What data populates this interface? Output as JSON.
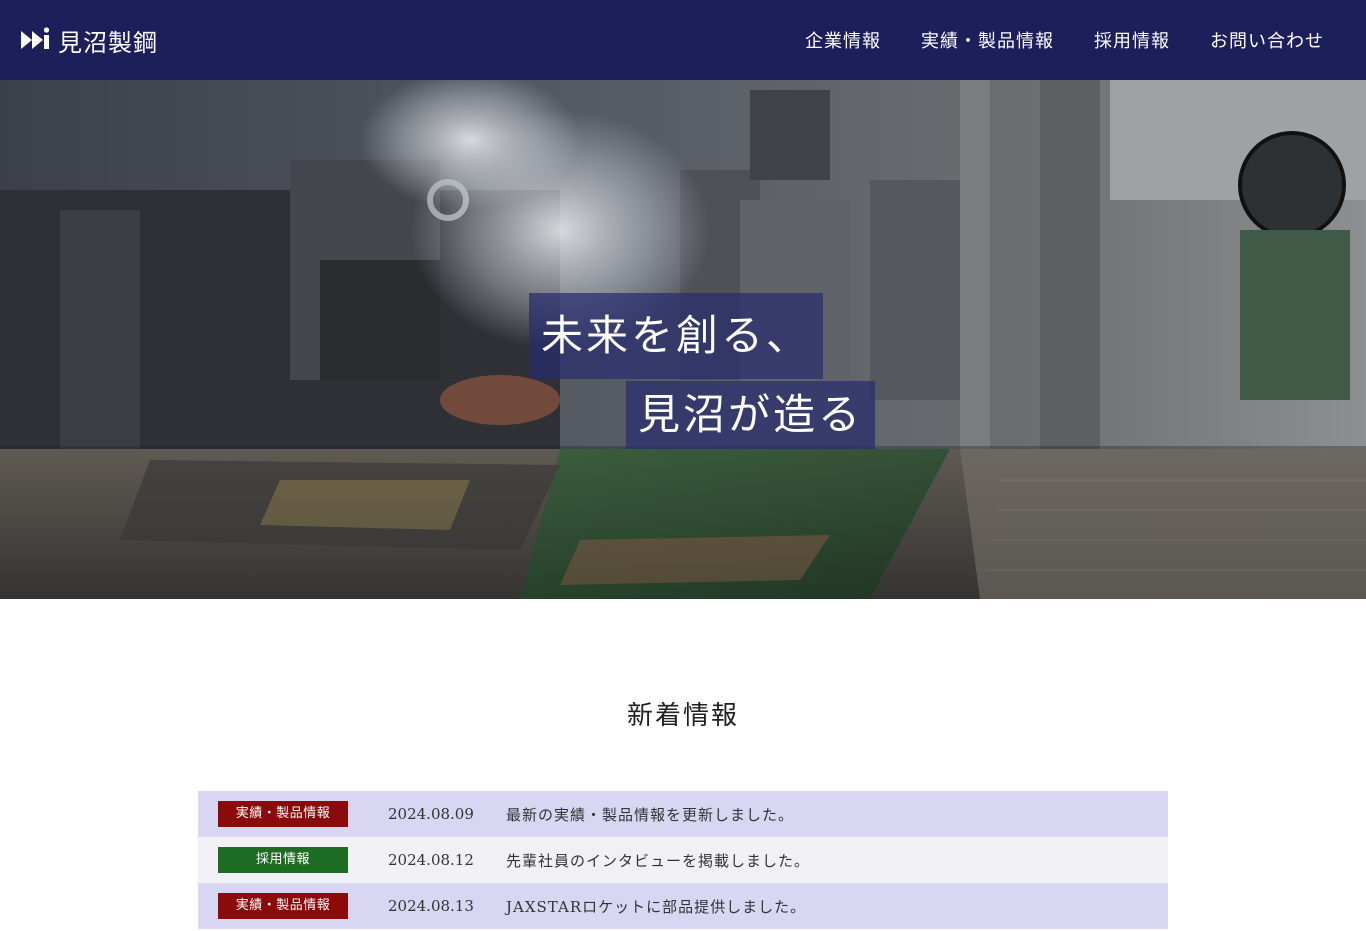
{
  "header": {
    "brand_name": "見沼製鋼",
    "nav": [
      {
        "label": "企業情報"
      },
      {
        "label": "実績・製品情報"
      },
      {
        "label": "採用情報"
      },
      {
        "label": "お問い合わせ"
      }
    ]
  },
  "hero": {
    "catch_line1": "未来を創る、",
    "catch_line2": "見沼が造る"
  },
  "news": {
    "title": "新着情報",
    "items": [
      {
        "tag": "実績・製品情報",
        "tag_color": "#8b0b0b",
        "date": "2024.08.09",
        "text": "最新の実績・製品情報を更新しました。"
      },
      {
        "tag": "採用情報",
        "tag_color": "#1e6b24",
        "date": "2024.08.12",
        "text": "先輩社員のインタビューを掲載しました。"
      },
      {
        "tag": "実績・製品情報",
        "tag_color": "#8b0b0b",
        "date": "2024.08.13",
        "text": "JAXSTARロケットに部品提供しました。"
      }
    ]
  },
  "colors": {
    "header_bg": "#1d1f5b",
    "row_a": "#d8d6f3",
    "row_b": "#f1f0f5"
  }
}
